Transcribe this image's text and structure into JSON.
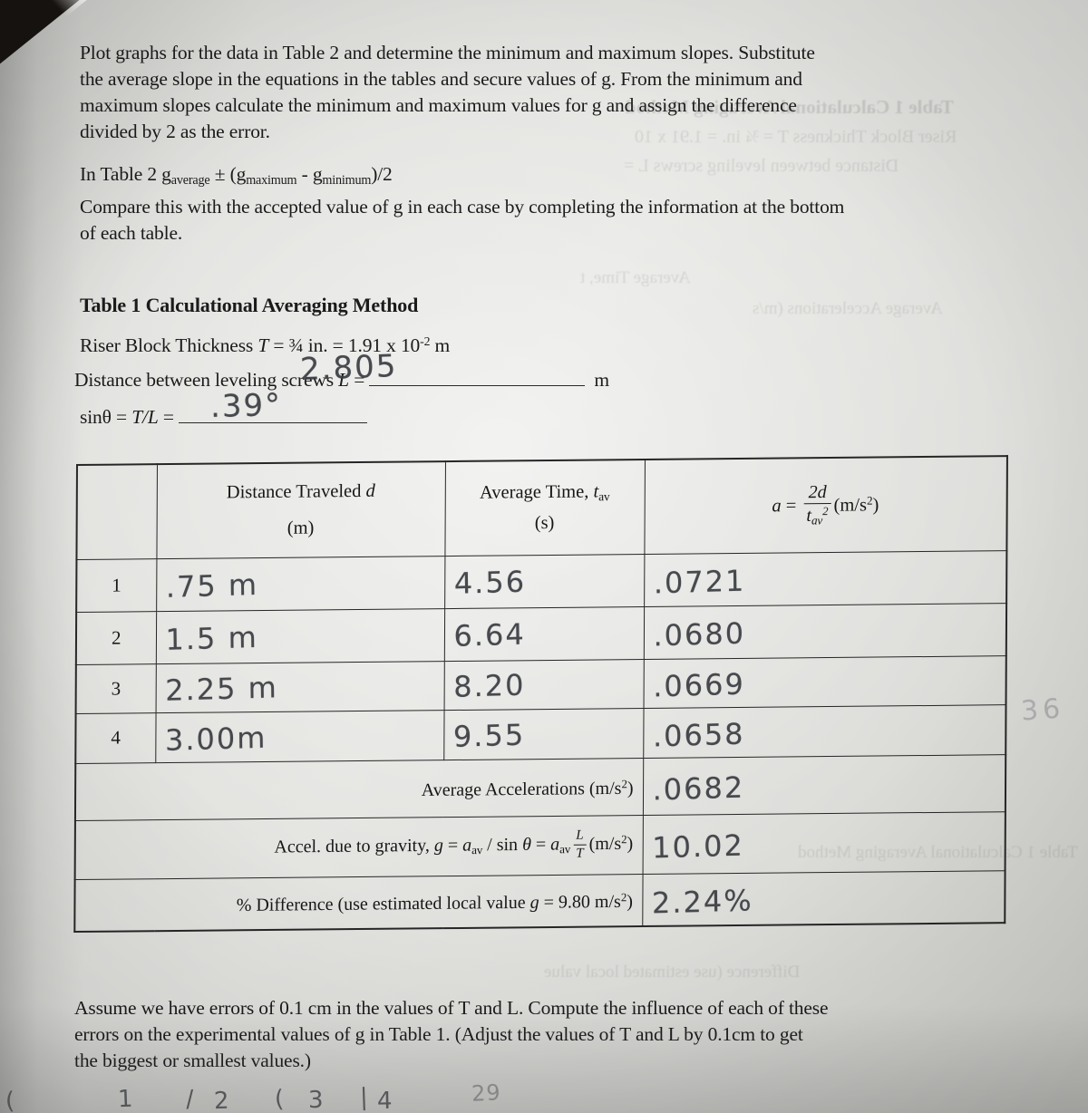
{
  "document": {
    "type": "scanned-lab-worksheet",
    "paper_color": "#ddddda",
    "ink_color": "#1b1b1b",
    "pencil_color": "#3a3d42"
  },
  "intro": {
    "paragraph1_lines": [
      "Plot graphs for the data in Table 2 and determine the minimum and maximum slopes.  Substitute",
      "the average slope in the equations in the tables and secure values of g.  From the minimum and",
      "maximum slopes calculate the minimum and maximum values for g and assign the difference",
      "divided by 2 as the error."
    ],
    "formula_line": {
      "prefix": "In Table 2 g",
      "sub1": "average",
      "mid": " ± (g",
      "sub2": "maximum",
      "mid2": " - g",
      "sub3": "minimum",
      "suffix": ")/2"
    },
    "paragraph2_lines": [
      "Compare this with the accepted value of g in each case by completing the information at the bottom",
      "of each table."
    ]
  },
  "table_header": {
    "title": "Table 1 Calculational Averaging Method",
    "riser": {
      "label": "Riser Block Thickness ",
      "symbol": "T",
      "value": " = ¾ in. = 1.91 x 10",
      "exponent": "-2",
      "unit": " m"
    },
    "distance_screws": {
      "label": "Distance between leveling screws ",
      "symbol": "L",
      "equals": " = ",
      "handwritten_value": "2.805",
      "unit": "m"
    },
    "sin_theta": {
      "label": "sinθ = ",
      "symbol": "T/L",
      "equals": " = ",
      "handwritten_value": ".39°"
    }
  },
  "table": {
    "columns": {
      "index": "",
      "distance_line1": "Distance Traveled ",
      "distance_symbol": "d",
      "distance_line2": "(m)",
      "time_line1": "Average Time, ",
      "time_symbol": "t",
      "time_subscript": "av",
      "time_line2": "(s)",
      "accel_prefix": "a",
      "accel_equals": " = ",
      "accel_numerator": "2d",
      "accel_denominator": "t",
      "accel_denominator_sub": "av",
      "accel_denominator_sup": "2",
      "accel_units": "(m/s",
      "accel_units_sup": "2",
      "accel_units_close": ")"
    },
    "rows": [
      {
        "index": "1",
        "distance": ".75 m",
        "time": "4.56",
        "accel": ".0721"
      },
      {
        "index": "2",
        "distance": "1.5 m",
        "time": "6.64",
        "accel": ".0680"
      },
      {
        "index": "3",
        "distance": "2.25 m",
        "time": "8.20",
        "accel": ".0669"
      },
      {
        "index": "4",
        "distance": "3.00m",
        "time": "9.55",
        "accel": ".0658"
      }
    ],
    "summary_rows": [
      {
        "label_plain": "Average Accelerations (m/s",
        "label_sup": "2",
        "label_close": ")",
        "value": ".0682"
      },
      {
        "label_plain": "Accel. due to gravity, ",
        "label_italic1": "g",
        "label_mid1": " = ",
        "label_italic2": "a",
        "label_sub1": "av",
        "label_mid2": " / sin ",
        "label_theta": "θ",
        "label_mid3": " = ",
        "label_italic3": "a",
        "label_sub2": "av",
        "label_frac_top": "L",
        "label_frac_bot": "T",
        "label_units": "(m/s",
        "label_units_sup": "2",
        "label_units_close": ")",
        "value": "10.02"
      },
      {
        "label_plain": "% Difference (use estimated local value ",
        "label_italic": "g",
        "label_rest": " = 9.80 m/s",
        "label_sup": "2",
        "label_close": ")",
        "value": "2.24%"
      }
    ]
  },
  "footer": {
    "lines": [
      "Assume we have errors of 0.1 cm in the values of T and L.  Compute the influence of each of these",
      "errors on the experimental values of g in Table 1. (Adjust the values of T and L by 0.1cm to get",
      "the biggest or smallest values.)"
    ]
  },
  "annotations": {
    "margin_note": "36",
    "bottom_scribbles": [
      "1",
      "2",
      "3",
      "4",
      "29"
    ]
  },
  "ghost_text": {
    "lines": [
      "Table 1 Calculational Averaging Method",
      "Riser Block Thickness  T = ¾ in. = 1.91 x 10",
      "Distance between leveling screws  L =",
      "Average Time, t",
      "Average Accelerations (m/s",
      "Difference (use estimated local value"
    ]
  }
}
